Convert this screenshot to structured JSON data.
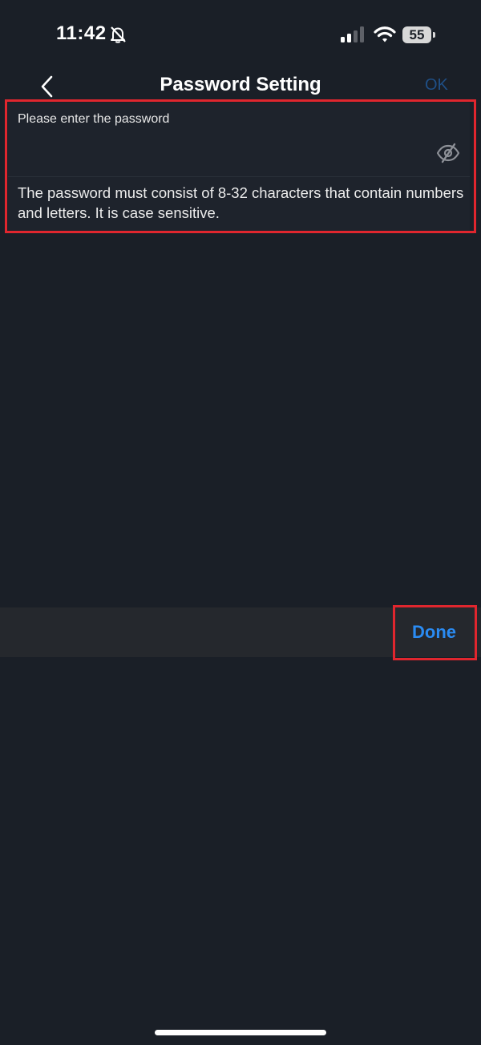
{
  "status_bar": {
    "time": "11:42",
    "battery_level": "55",
    "icons": [
      "bell-slash-icon",
      "cellular-signal-icon",
      "wifi-icon",
      "battery-icon"
    ]
  },
  "nav": {
    "title": "Password Setting",
    "ok_label": "OK",
    "back_icon": "chevron-left-icon"
  },
  "form": {
    "label": "Please enter the password",
    "password_value": "",
    "visibility_icon": "eye-slash-icon",
    "hint": "The password must consist of 8-32 characters that contain numbers and letters. It is case sensitive."
  },
  "keyboard_toolbar": {
    "done_label": "Done"
  },
  "colors": {
    "background": "#1a1f27",
    "card": "#1e232c",
    "accent": "#2a8bf2",
    "ok_disabled": "#1f4f86",
    "highlight": "#e0262e",
    "toolbar": "#25282d"
  }
}
